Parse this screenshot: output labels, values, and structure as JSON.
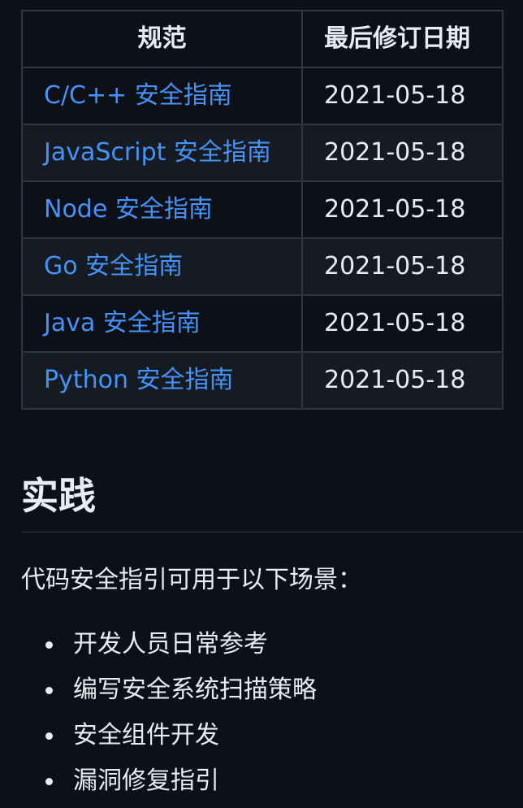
{
  "table": {
    "headers": {
      "spec": "规范",
      "last_revised": "最后修订日期"
    },
    "rows": [
      {
        "spec": "C/C++ 安全指南",
        "date": "2021-05-18"
      },
      {
        "spec": "JavaScript 安全指南",
        "date": "2021-05-18"
      },
      {
        "spec": "Node 安全指南",
        "date": "2021-05-18"
      },
      {
        "spec": "Go 安全指南",
        "date": "2021-05-18"
      },
      {
        "spec": "Java 安全指南",
        "date": "2021-05-18"
      },
      {
        "spec": "Python 安全指南",
        "date": "2021-05-18"
      }
    ]
  },
  "practice": {
    "heading": "实践",
    "intro": "代码安全指引可用于以下场景：",
    "items": [
      "开发人员日常参考",
      "编写安全系统扫描策略",
      "安全组件开发",
      "漏洞修复指引"
    ]
  },
  "colors": {
    "background": "#0d1117",
    "stripe": "#161b22",
    "border": "#30363d",
    "link": "#4493f8",
    "text": "#e6edf3"
  }
}
